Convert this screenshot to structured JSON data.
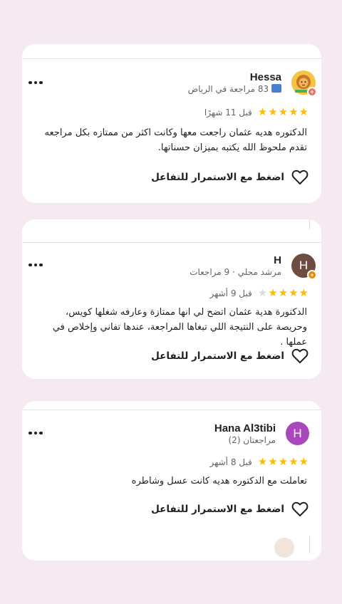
{
  "reviews": [
    {
      "name": "Hessa",
      "meta": "83 مراجعة في الرياض",
      "avatar_letter": "",
      "time": "قبل 11 شهرًا",
      "rating": 5,
      "text": "الدكتوره هديه عثمان راجعت معها وكانت اكثر من ممتازه بكل مراجعه تقدم ملحوظ الله يكتبه بميزان حسناتها.",
      "action": "اضغط مع الاستمرار للتفاعل"
    },
    {
      "name": "H",
      "meta": "مرشد محلي · 9 مراجعات",
      "avatar_letter": "H",
      "avatar_color": "#6d4c41",
      "time": "قبل 9 أشهر",
      "rating": 4,
      "text": "الدكتورة هدية عثمان اتضح لي انها ممتازة وعارفه شغلها كويس، وحريصة على النتيجة اللي تبغاها المراجعة، عندها تفاني وإخلاص في عملها .",
      "action": "اضغط مع الاستمرار للتفاعل"
    },
    {
      "name": "Hana Al3tibi",
      "meta": "مراجعتان (2)",
      "avatar_letter": "H",
      "avatar_color": "#ab47bc",
      "time": "قبل 8 أشهر",
      "rating": 5,
      "text": "تعاملت مع الدكتوره هديه كانت عسل وشاطره",
      "action": "اضغط مع الاستمرار للتفاعل"
    }
  ],
  "colors": {
    "background": "#f6e9f2",
    "star": "#fbbc04",
    "star_off": "#dadce0"
  }
}
